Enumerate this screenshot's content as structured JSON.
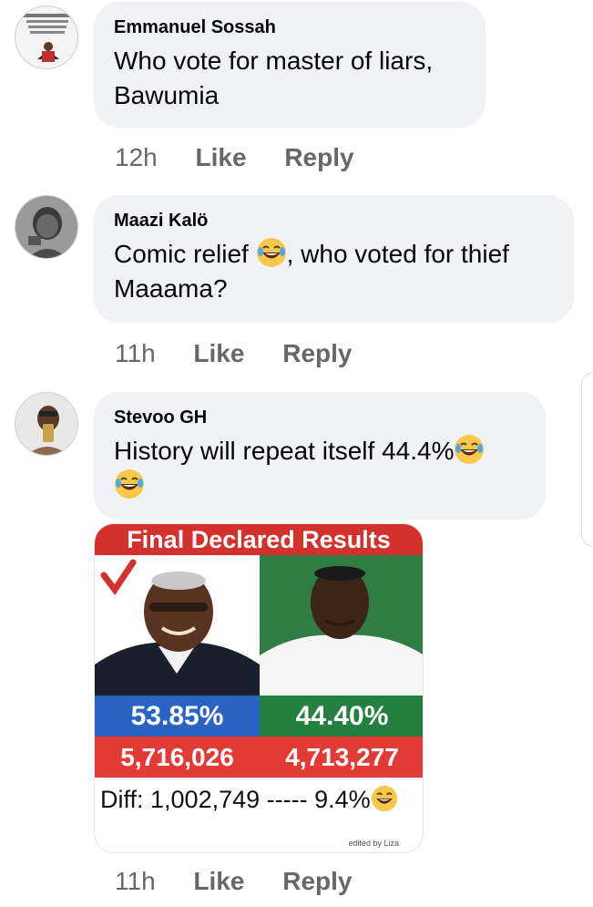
{
  "comments": [
    {
      "author": "Emmanuel Sossah",
      "text_line1": "Who vote for master of liars,",
      "text_line2": "Bawumia",
      "time": "12h",
      "like_label": "Like",
      "reply_label": "Reply",
      "avatar_icon": "profile-photo-icon"
    },
    {
      "author": "Maazi Kalö",
      "text_part1": "Comic relief ",
      "text_part2": ", who voted for thief",
      "text_line2": "Maaama?",
      "emoji": "laughing-tears-emoji",
      "time": "11h",
      "like_label": "Like",
      "reply_label": "Reply",
      "avatar_icon": "profile-photo-icon"
    },
    {
      "author": "Stevoo GH",
      "text_line1": "History will repeat itself 44.4%",
      "emoji": "laughing-tears-emoji",
      "time": "11h",
      "like_label": "Like",
      "reply_label": "Reply",
      "avatar_icon": "profile-photo-icon"
    }
  ],
  "result_image": {
    "title": "Final Declared Results",
    "left_percent": "53.85%",
    "right_percent": "44.40%",
    "left_votes": "5,716,026",
    "right_votes": "4,713,277",
    "diff_text": "Diff: 1,002,749 ----- 9.4%",
    "edited_by": "edited by Liza",
    "colors": {
      "title_bg": "#d3312e",
      "left_percent_bg": "#2b63c4",
      "right_percent_bg": "#24803f",
      "votes_bg": "#e23b35"
    }
  }
}
